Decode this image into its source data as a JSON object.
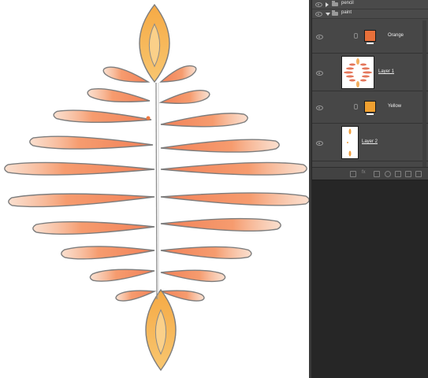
{
  "layers_panel": {
    "groups": [
      {
        "name": "pencil",
        "expanded": false
      },
      {
        "name": "paint",
        "expanded": true
      }
    ],
    "layers": [
      {
        "name": "Orange",
        "kind": "fill",
        "color": "#e8703a"
      },
      {
        "name": "Layer 1",
        "kind": "pixel"
      },
      {
        "name": "Yellow",
        "kind": "fill",
        "color": "#f0a030"
      },
      {
        "name": "Layer 2",
        "kind": "pixel"
      }
    ],
    "footer_icons": [
      "link-icon",
      "fx-icon",
      "mask-icon",
      "adjustment-icon",
      "folder-icon",
      "new-layer-icon",
      "trash-icon"
    ]
  },
  "canvas": {
    "background": "#ffffff",
    "paint_colors": [
      "#f07840",
      "#f5a040",
      "#f2c070"
    ]
  }
}
